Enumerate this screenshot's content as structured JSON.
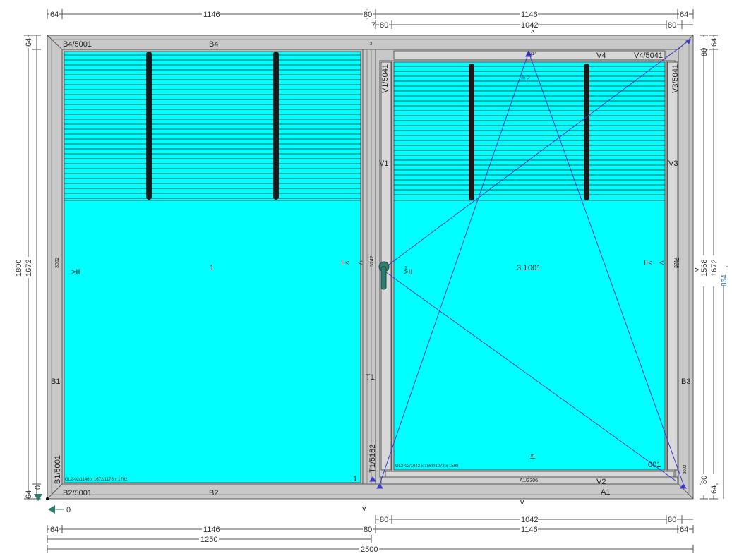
{
  "dimensions": {
    "top_row1": [
      "64",
      "1146",
      "80",
      "1146",
      "64"
    ],
    "top_row2": [
      "80",
      "1042",
      "80"
    ],
    "bottom_row1": [
      "80",
      "1042",
      "80"
    ],
    "bottom_row2": [
      "64",
      "1146",
      "80",
      "1146",
      "64"
    ],
    "bottom_half": "1250",
    "bottom_total": "2500",
    "left_top": "64",
    "left_total": "1800",
    "left_mid": "1672",
    "left_bottom": "64",
    "right_top_outer": "64",
    "right_top_inner": "80",
    "right_mid_outer": "1672",
    "right_mid_inner": "1568",
    "right_bottom_inner": "80",
    "right_bottom_outer": "64",
    "right_handle": "864",
    "origin_y": "0",
    "origin_x": "0"
  },
  "frame": {
    "top": "B4",
    "top_code": "B4/5001",
    "bottom": "B2",
    "bottom_code": "B2/5001",
    "left": "B1",
    "left_code": "B1/5001",
    "right": "B3",
    "mullion": "T1",
    "mullion_code": "T1/5182",
    "mullion_num": "3242",
    "left_num": "3002",
    "right_num": "3002"
  },
  "left_pane": {
    "number": "1",
    "corner_number": "1",
    "arrow_left": ">II",
    "arrow_right": "II<",
    "glass": "GL2-02/1146 x 1672/1176 x 1702"
  },
  "sash": {
    "top": "V4",
    "top_code": "V4/5041",
    "bottom": "V2",
    "left": "V1",
    "left_code": "V1/5041",
    "right": "V3",
    "right_code": "V3/5041",
    "bottom_code": "A1/3306",
    "bottom_label": "A1",
    "top_num": "3214",
    "sash_num": "3214",
    "pane_number": "3.1",
    "pane_number_alt": "001",
    "corner_number": "001",
    "top_marker": "≚2",
    "bottom_marker": "≞",
    "arrow_left": ">II",
    "arrow_right": "II<",
    "handle_mark": "1",
    "glass": "GL2-02/1042 x 1568/1072 x 1598"
  },
  "misc": {
    "top_caret": "^",
    "bottom_caret": "v",
    "right_caret": ">",
    "left_caret": "<",
    "small_num": "3",
    "top_seven": "7"
  },
  "colors": {
    "glass": "#00ffff",
    "frame": "#c8c8c8",
    "frame_edge": "#5a5a5a",
    "opening_lines": "#3c3cc8",
    "dim_lines": "#555555",
    "handle": "#2e7d6f"
  }
}
